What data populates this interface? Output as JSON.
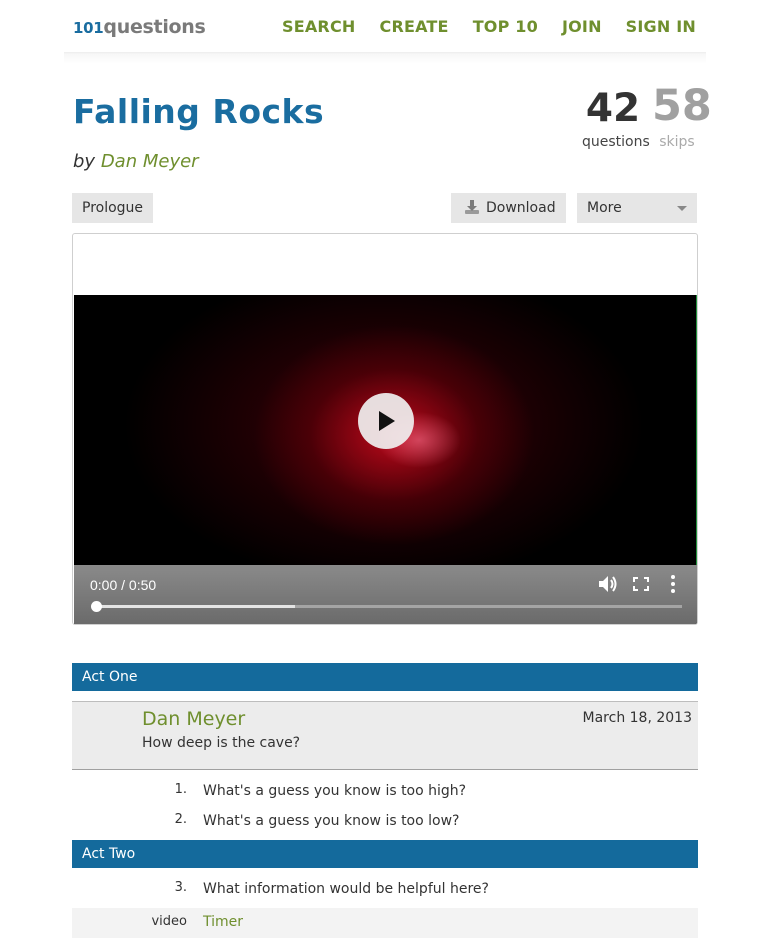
{
  "header": {
    "logo_num": "101",
    "logo_word": "questions",
    "nav": [
      "SEARCH",
      "CREATE",
      "TOP 10",
      "JOIN",
      "SIGN IN"
    ]
  },
  "title": "Falling Rocks",
  "byline": {
    "prefix": "by",
    "author": "Dan Meyer"
  },
  "stats": {
    "questions_count": "42",
    "questions_label": "questions",
    "skips_count": "58",
    "skips_label": "skips"
  },
  "toolbar": {
    "prologue": "Prologue",
    "download": "Download",
    "more": "More"
  },
  "video": {
    "time": "0:00 / 0:50",
    "buffered_fraction": 0.34,
    "played_fraction": 0
  },
  "acts": {
    "one": "Act One",
    "two": "Act Two"
  },
  "question": {
    "author": "Dan Meyer",
    "date": "March 18, 2013",
    "text": "How deep is the cave?"
  },
  "items": [
    {
      "num": "1.",
      "text": "What's a guess you know is too high?"
    },
    {
      "num": "2.",
      "text": "What's a guess you know is too low?"
    },
    {
      "num": "3.",
      "text": "What information would be helpful here?"
    }
  ],
  "media": {
    "kind": "video",
    "label": "Timer"
  },
  "colors": {
    "brand_blue": "#1a6da0",
    "act_bar": "#146a9c",
    "link_green": "#6f8f2e"
  },
  "icons": [
    "download-icon",
    "caret-down-icon",
    "play-icon",
    "volume-icon",
    "fullscreen-icon",
    "more-vert-icon"
  ]
}
